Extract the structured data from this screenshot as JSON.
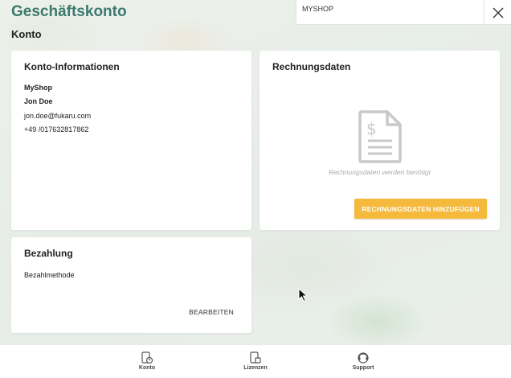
{
  "header": {
    "title": "Geschäftskonto",
    "subtitle": "Konto"
  },
  "shop_bar": {
    "shop_name": "MYSHOP",
    "close_icon": "close-icon"
  },
  "account_info": {
    "title": "Konto-Informationen",
    "company": "MyShop",
    "name": "Jon Doe",
    "email": "jon.doe@fukaru.com",
    "phone": "+49 /017632817862"
  },
  "billing": {
    "title": "Rechnungsdaten",
    "icon": "invoice-document-icon",
    "empty_message": "Rechnungsdaten werden benötigt",
    "add_button": "RECHNUNGSDATEN HINZUFÜGEN"
  },
  "payment": {
    "title": "Bezahlung",
    "method_label": "Bezahlmethode",
    "edit_button": "BEARBEITEN"
  },
  "bottom_nav": {
    "items": [
      {
        "label": "Konto",
        "icon": "account-device-icon"
      },
      {
        "label": "Lizenzen",
        "icon": "license-device-icon"
      },
      {
        "label": "Support",
        "icon": "support-headset-icon"
      }
    ]
  },
  "colors": {
    "title": "#3c7a6e",
    "accent_button": "#f5b93c"
  }
}
